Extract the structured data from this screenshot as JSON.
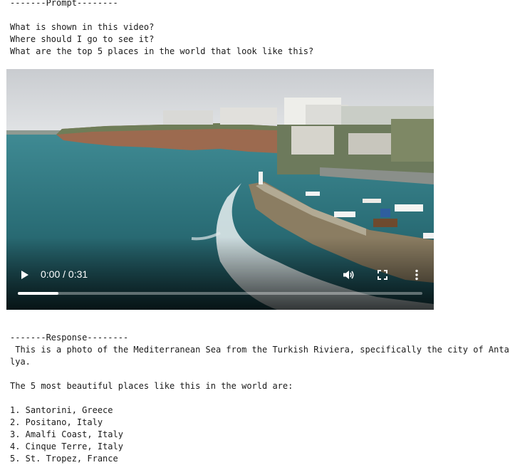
{
  "prompt": {
    "header": "-------Prompt--------",
    "lines": [
      "What is shown in this video?",
      "Where should I go to see it?",
      "What are the top 5 places in the world that look like this?"
    ]
  },
  "video": {
    "time_display": "0:00 / 0:31",
    "progress": 0.1,
    "icons": {
      "play": "play-icon",
      "volume": "volume-icon",
      "fullscreen": "fullscreen-icon",
      "more": "more-vertical-icon"
    }
  },
  "response": {
    "header": "-------Response--------",
    "paragraph_line1": " This is a photo of the Mediterranean Sea from the Turkish Riviera, specifically the city of Anta",
    "paragraph_line2": "lya.",
    "intro": "The 5 most beautiful places like this in the world are:",
    "list": [
      "1. Santorini, Greece",
      "2. Positano, Italy",
      "3. Amalfi Coast, Italy",
      "4. Cinque Terre, Italy",
      "5. St. Tropez, France"
    ]
  }
}
